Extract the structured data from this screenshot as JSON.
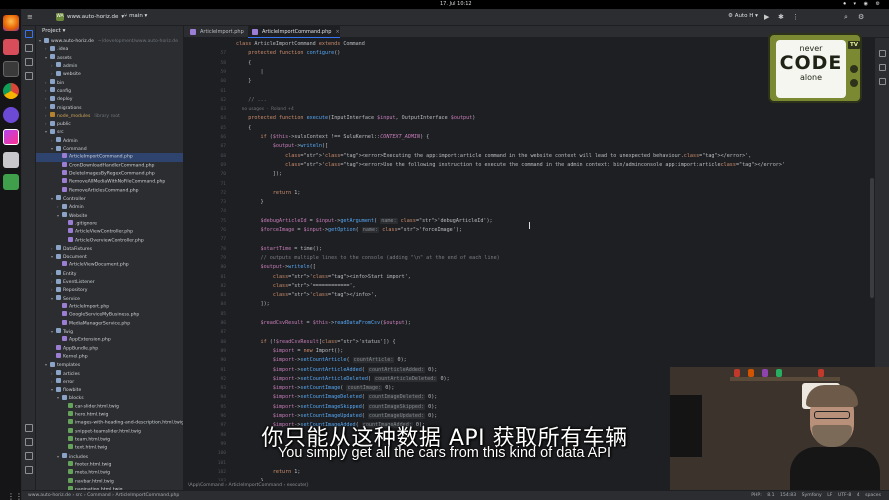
{
  "system": {
    "clock": "17. Jul  10:12",
    "tray": "⏺ ▾ ◉ ⚙"
  },
  "ide": {
    "project_name": "www.auto-horiz.de",
    "project_badge": "WA",
    "branch": "main",
    "run_config": "Auto H",
    "project_panel_title": "Project"
  },
  "tabs": [
    {
      "label": "ArticleImport.php",
      "active": false
    },
    {
      "label": "ArticleImportCommand.php",
      "active": true
    }
  ],
  "tree": [
    {
      "label": "www.auto-horiz.de",
      "hint": "~/development/www.auto-horiz.de",
      "type": "folder",
      "open": true
    },
    {
      "label": ".idea",
      "type": "folder"
    },
    {
      "label": "assets",
      "type": "folder",
      "open": true
    },
    {
      "label": "admin",
      "type": "folder"
    },
    {
      "label": "website",
      "type": "folder"
    },
    {
      "label": "bin",
      "type": "folder"
    },
    {
      "label": "config",
      "type": "folder"
    },
    {
      "label": "deploy",
      "type": "folder"
    },
    {
      "label": "migrations",
      "type": "folder"
    },
    {
      "label": "node_modules",
      "hint": "library root",
      "type": "excluded"
    },
    {
      "label": "public",
      "type": "folder"
    },
    {
      "label": "src",
      "type": "folder",
      "open": true
    },
    {
      "label": "Admin",
      "type": "folder"
    },
    {
      "label": "Command",
      "type": "folder",
      "open": true
    },
    {
      "label": "ArticleImportCommand.php",
      "type": "php",
      "selected": true
    },
    {
      "label": "CronDownloadHandlerCommand.php",
      "type": "php"
    },
    {
      "label": "DeleteImagesByRegexCommand.php",
      "type": "php"
    },
    {
      "label": "RemoveAllMediaWithNoFileCommand.php",
      "type": "php"
    },
    {
      "label": "RemoveArticlesCommand.php",
      "type": "php"
    },
    {
      "label": "Controller",
      "type": "folder",
      "open": true
    },
    {
      "label": "Admin",
      "type": "folder"
    },
    {
      "label": "Website",
      "type": "folder",
      "open": true
    },
    {
      "label": ".gitignore",
      "type": "php"
    },
    {
      "label": "ArticleViewController.php",
      "type": "php"
    },
    {
      "label": "ArticleOverviewController.php",
      "type": "php"
    },
    {
      "label": "DataFixtures",
      "type": "folder"
    },
    {
      "label": "Document",
      "type": "folder",
      "open": true
    },
    {
      "label": "ArticleViewDocument.php",
      "type": "php"
    },
    {
      "label": "Entity",
      "type": "folder"
    },
    {
      "label": "EventListener",
      "type": "folder"
    },
    {
      "label": "Repository",
      "type": "folder"
    },
    {
      "label": "Service",
      "type": "folder",
      "open": true
    },
    {
      "label": "ArticleImport.php",
      "type": "php"
    },
    {
      "label": "GoogleServiceMyBusiness.php",
      "type": "php"
    },
    {
      "label": "MediaManagerService.php",
      "type": "php"
    },
    {
      "label": "Twig",
      "type": "folder",
      "open": true
    },
    {
      "label": "AppExtension.php",
      "type": "php"
    },
    {
      "label": "AppBundle.php",
      "type": "php"
    },
    {
      "label": "Kernel.php",
      "type": "php"
    },
    {
      "label": "templates",
      "type": "folder",
      "open": true
    },
    {
      "label": "articles",
      "type": "folder"
    },
    {
      "label": "error",
      "type": "folder"
    },
    {
      "label": "flowbite",
      "type": "folder",
      "open": true
    },
    {
      "label": "blocks",
      "type": "folder",
      "open": true
    },
    {
      "label": "car-slider.html.twig",
      "type": "twig"
    },
    {
      "label": "hero.html.twig",
      "type": "twig"
    },
    {
      "label": "images-with-heading-and-description.html.twig",
      "type": "twig"
    },
    {
      "label": "snippet-teamslider.html.twig",
      "type": "twig"
    },
    {
      "label": "team.html.twig",
      "type": "twig"
    },
    {
      "label": "text.html.twig",
      "type": "twig"
    },
    {
      "label": "includes",
      "type": "folder",
      "open": true
    },
    {
      "label": "footer.html.twig",
      "type": "twig"
    },
    {
      "label": "meta.html.twig",
      "type": "twig"
    },
    {
      "label": "navbar.html.twig",
      "type": "twig"
    },
    {
      "label": "pagination.html.twig",
      "type": "twig"
    },
    {
      "label": "pages",
      "type": "folder"
    }
  ],
  "code": {
    "line_numbers": [
      "",
      "57",
      "58",
      "59",
      "60",
      "61",
      "62",
      "63",
      "64",
      "65",
      "66",
      "67",
      "68",
      "69",
      "70",
      "71",
      "72",
      "73",
      "74",
      "75",
      "76",
      "77",
      "78",
      "79",
      "80",
      "81",
      "82",
      "83",
      "84",
      "85",
      "86",
      "87",
      "88",
      "89",
      "90",
      "91",
      "92",
      "93",
      "94",
      "95",
      "96",
      "97",
      "98",
      "99",
      "100",
      "101",
      "102",
      "103",
      "104",
      "105"
    ],
    "lines": [
      "class ArticleImportCommand extends Command",
      "    protected function configure()",
      "    {",
      "        |",
      "    }",
      "",
      "    // ...",
      "    no usages  ·  Roland +4",
      "    protected function execute(InputInterface $input, OutputInterface $output)",
      "    {",
      "        if ($this->sulsContext !== SuluKernel::CONTEXT_ADMIN) {",
      "            $output->writeln([",
      "                '<error>Executing the app:import:article command in the website context will lead to unexpected behaviour.</error>',",
      "                '<error>Use the following instruction to execute the command in the admin context: bin/adminconsole app:import:article</error>'",
      "            ]);",
      "",
      "            return 1;",
      "        }",
      "",
      "        $debugArticleId = $input->getArgument( name: 'debugArticleId');",
      "        $forceImage = $input->getOption( name: 'forceImage');",
      "",
      "        $startTime = time();",
      "        // outputs multiple lines to the console (adding \"\\n\" at the end of each line)",
      "        $output->writeln([",
      "            '<info>Start import',",
      "            '============',",
      "            '</info>',",
      "        ]);",
      "",
      "        $readCsvResult = $this->readDataFromCsv($output);",
      "",
      "        if (!$readCsvResult['status']) {",
      "            $import = new Import();",
      "            $import->setCountArticle( countArticle: 0);",
      "            $import->setCountArticleAdded( countArticleAdded: 0);",
      "            $import->setCountArticleDeleted( countArticleDeleted: 0);",
      "            $import->setCountImage( countImage: 0);",
      "            $import->setCountImageDeleted( countImageDeleted: 0);",
      "            $import->setCountImageSkipped( countImageSkipped: 0);",
      "            $import->setCountImageUpdated( countImageUpdated: 0);",
      "            $import->setCountImageAdded( countImageAdded: 0);",
      "",
      "",
      "",
      "",
      "            return 1;",
      "        }"
    ]
  },
  "crumbs": "\\App\\Command   ›   ArticleImportCommand   ›   execute()",
  "status": {
    "breadcrumb": "www.auto-horiz.de  ›  src  ›  Command  ›  ArticleImportCommand.php",
    "right": "PHP: 8.1    154:83    Symfony    LF    UTF-8    4 spaces"
  },
  "logo": {
    "line1": "never",
    "line2": "CODE",
    "line3": "alone",
    "badge": "TV"
  },
  "webcam": {
    "mug_text": "{CODE}"
  },
  "subtitles": {
    "chinese": "你只能从这种数据 API 获取所有车辆",
    "english": "You simply get all the cars from this kind of data API"
  },
  "colors": {
    "accent": "#3574f0",
    "editor_bg": "#1e1f22",
    "panel_bg": "#2b2d30",
    "logo_green": "#7b8a32"
  }
}
